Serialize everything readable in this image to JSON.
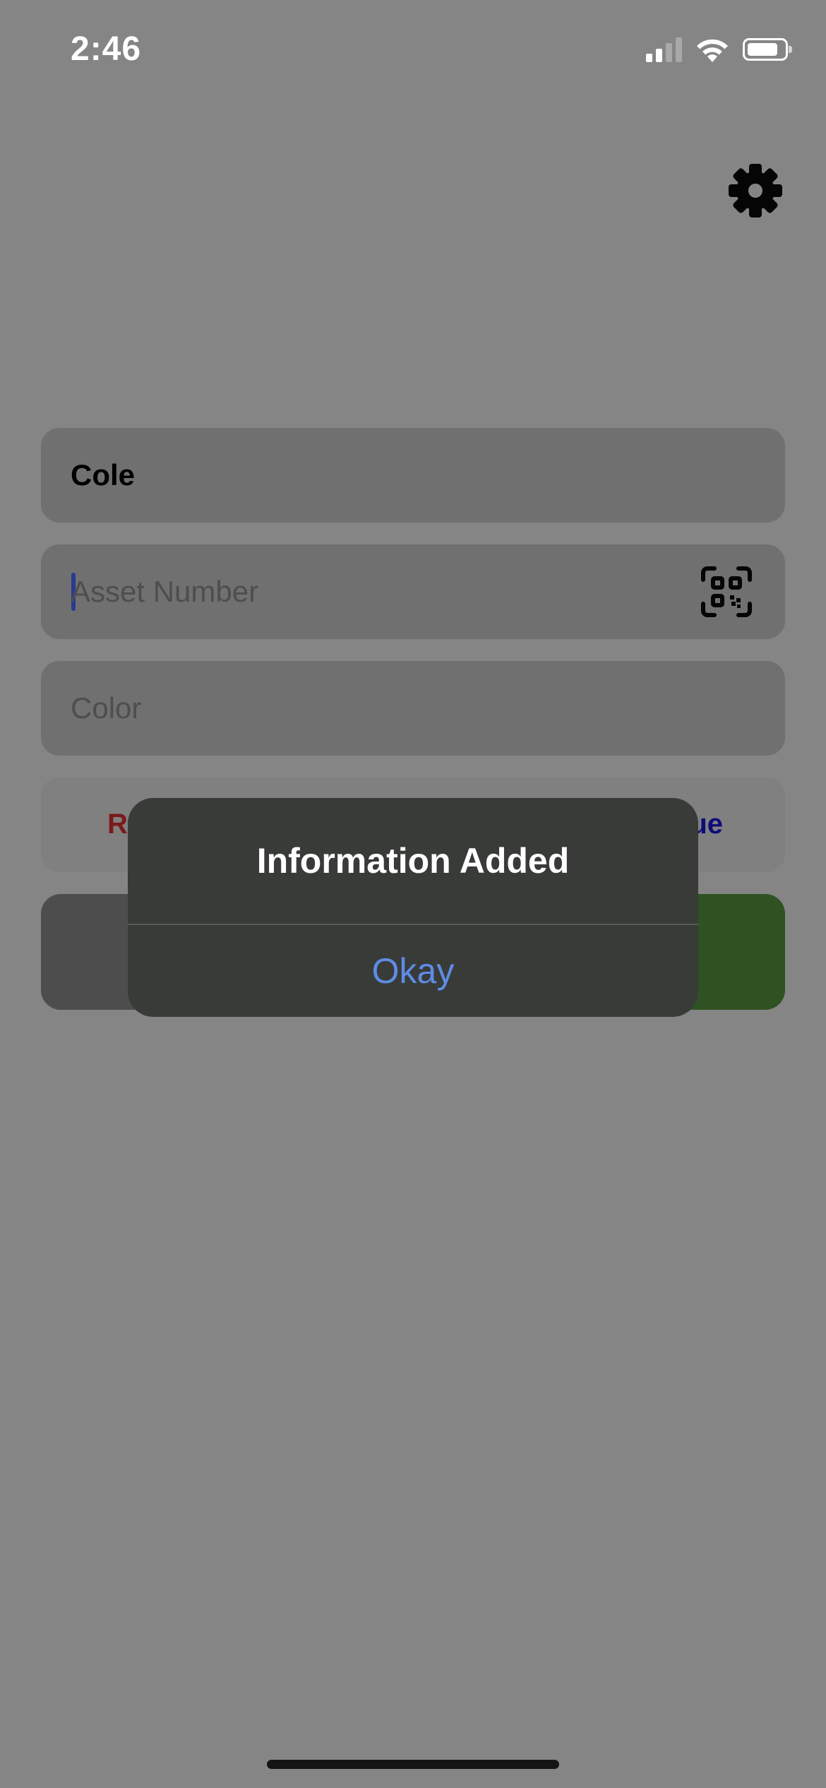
{
  "status_bar": {
    "time": "2:46",
    "icons": [
      "cellular-signal-icon",
      "wifi-icon",
      "battery-icon"
    ]
  },
  "header": {
    "settings_icon": "gear-icon"
  },
  "form": {
    "name_value": "Cole",
    "asset_placeholder": "Asset Number",
    "asset_scan_icon": "qr-code-icon",
    "color_placeholder": "Color",
    "color_options": [
      {
        "label": "R",
        "color": "#7a1a1a"
      },
      {
        "label": "ue",
        "color": "#0c0c7a"
      }
    ]
  },
  "buttons": {
    "clear_color": "#4d4d4d",
    "save_color": "#2f5222"
  },
  "alert": {
    "title": "Information Added",
    "ok_label": "Okay",
    "ok_color": "#5e8ce6"
  }
}
